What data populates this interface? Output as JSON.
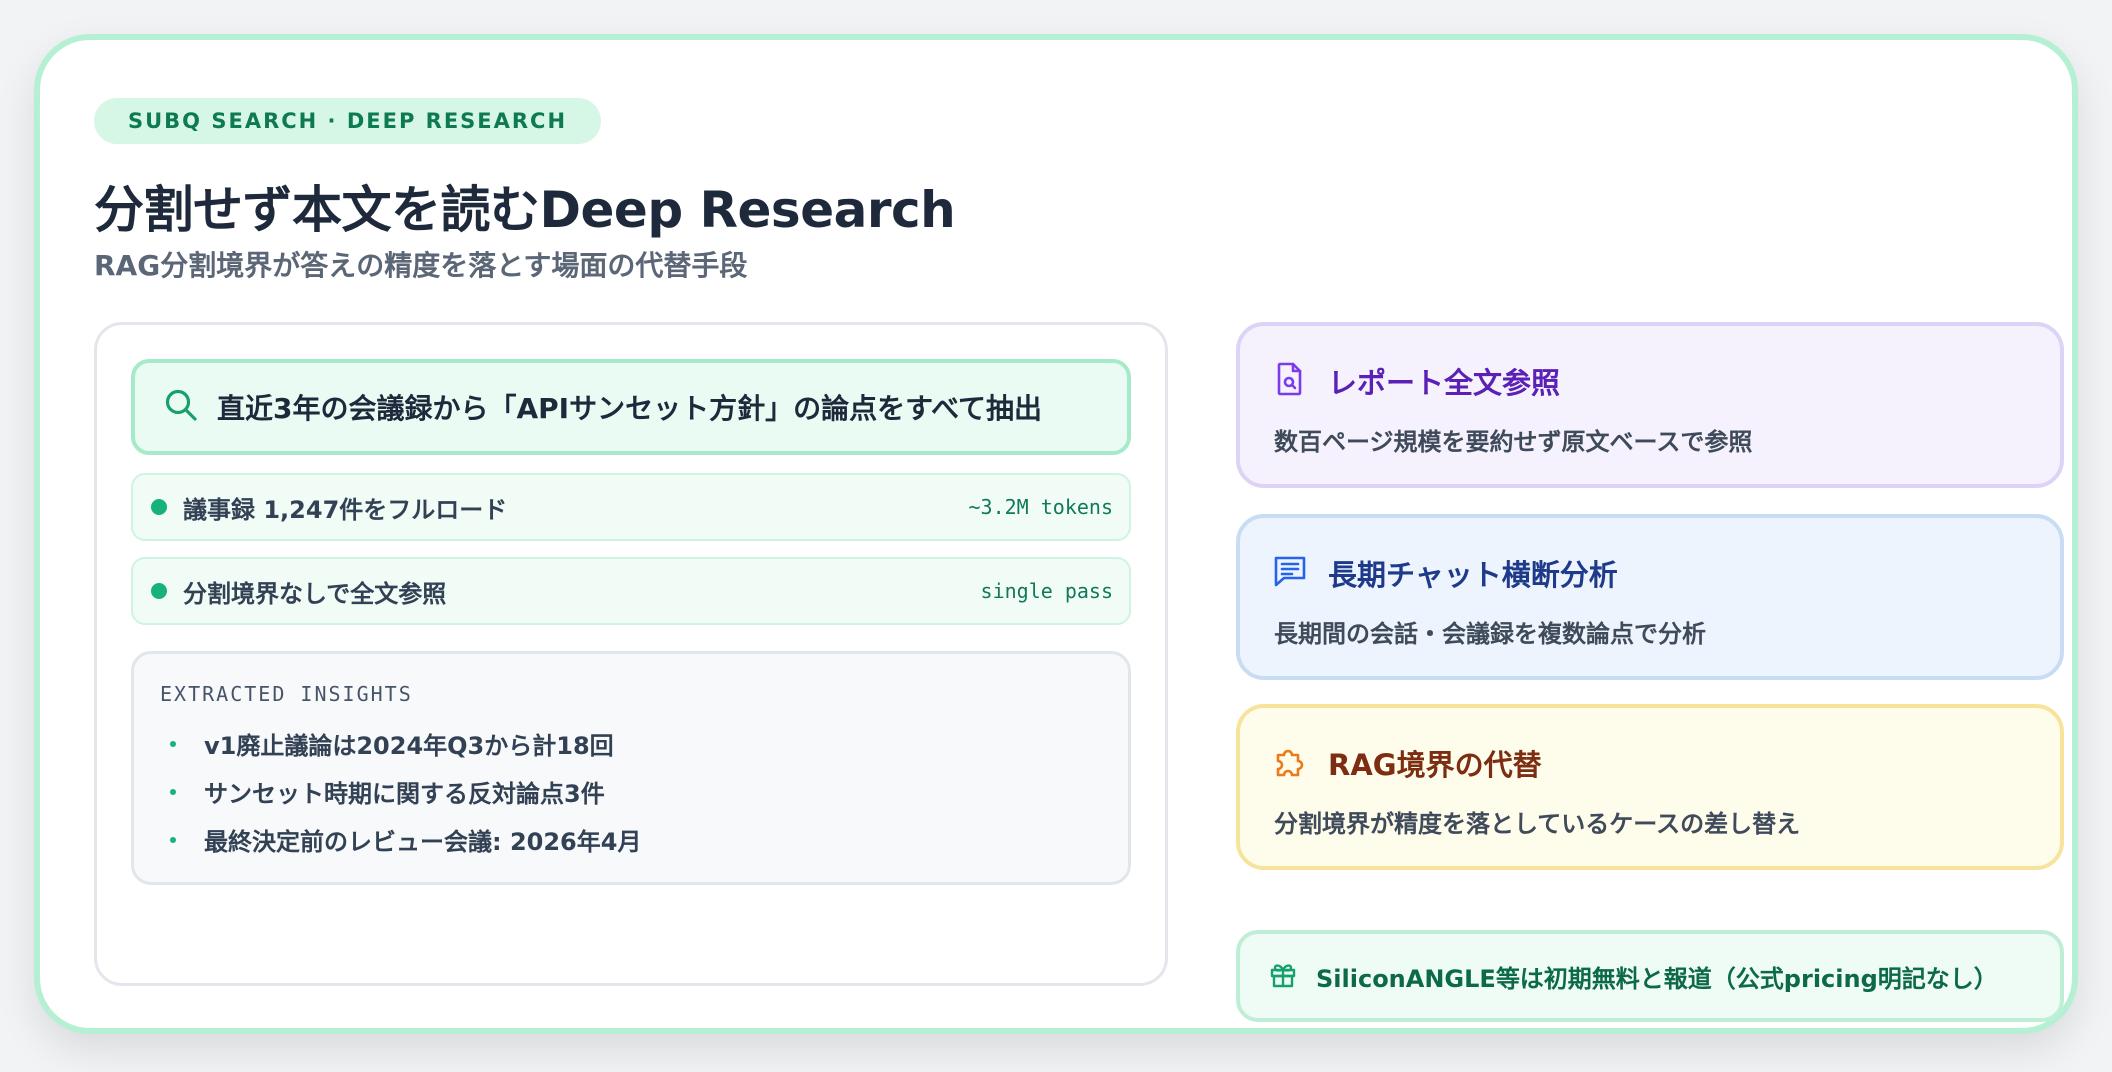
{
  "badge": "SUBQ SEARCH · DEEP RESEARCH",
  "title": "分割せず本文を読むDeep Research",
  "subtitle": "RAG分割境界が答えの精度を落とす場面の代替手段",
  "query": {
    "icon": "search-icon",
    "text": "直近3年の会議録から「APIサンセット方針」の論点をすべて抽出"
  },
  "steps": [
    {
      "label": "議事録 1,247件をフルロード",
      "meta": "~3.2M tokens"
    },
    {
      "label": "分割境界なしで全文参照",
      "meta": "single pass"
    }
  ],
  "insights": {
    "heading": "EXTRACTED INSIGHTS",
    "items": [
      "v1廃止議論は2024年Q3から計18回",
      "サンセット時期に関する反対論点3件",
      "最終決定前のレビュー会議: 2026年4月"
    ]
  },
  "features": [
    {
      "icon": "document-search-icon",
      "title": "レポート全文参照",
      "desc": "数百ページ規模を要約せず原文ベースで参照",
      "color": "#5b21b6"
    },
    {
      "icon": "chat-lines-icon",
      "title": "長期チャット横断分析",
      "desc": "長期間の会話・会議録を複数論点で分析",
      "color": "#1e3a8a"
    },
    {
      "icon": "puzzle-icon",
      "title": "RAG境界の代替",
      "desc": "分割境界が精度を落としているケースの差し替え",
      "color": "#7c2d12"
    }
  ],
  "note": {
    "icon": "gift-icon",
    "text": "SiliconANGLE等は初期無料と報道（公式pricing明記なし）"
  },
  "colors": {
    "accent": "#17b27a",
    "border": "#b6f0d4"
  }
}
